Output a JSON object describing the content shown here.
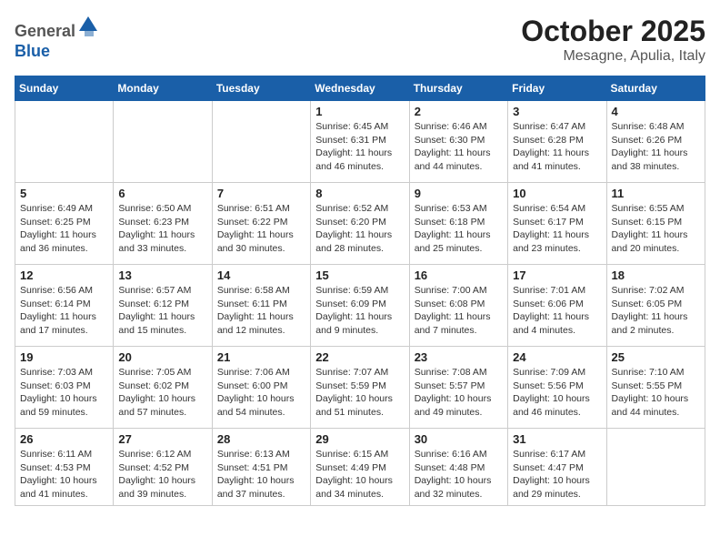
{
  "header": {
    "logo": {
      "general": "General",
      "blue": "Blue"
    },
    "title": "October 2025",
    "location": "Mesagne, Apulia, Italy"
  },
  "weekdays": [
    "Sunday",
    "Monday",
    "Tuesday",
    "Wednesday",
    "Thursday",
    "Friday",
    "Saturday"
  ],
  "weeks": [
    [
      {
        "day": "",
        "info": ""
      },
      {
        "day": "",
        "info": ""
      },
      {
        "day": "",
        "info": ""
      },
      {
        "day": "1",
        "info": "Sunrise: 6:45 AM\nSunset: 6:31 PM\nDaylight: 11 hours\nand 46 minutes."
      },
      {
        "day": "2",
        "info": "Sunrise: 6:46 AM\nSunset: 6:30 PM\nDaylight: 11 hours\nand 44 minutes."
      },
      {
        "day": "3",
        "info": "Sunrise: 6:47 AM\nSunset: 6:28 PM\nDaylight: 11 hours\nand 41 minutes."
      },
      {
        "day": "4",
        "info": "Sunrise: 6:48 AM\nSunset: 6:26 PM\nDaylight: 11 hours\nand 38 minutes."
      }
    ],
    [
      {
        "day": "5",
        "info": "Sunrise: 6:49 AM\nSunset: 6:25 PM\nDaylight: 11 hours\nand 36 minutes."
      },
      {
        "day": "6",
        "info": "Sunrise: 6:50 AM\nSunset: 6:23 PM\nDaylight: 11 hours\nand 33 minutes."
      },
      {
        "day": "7",
        "info": "Sunrise: 6:51 AM\nSunset: 6:22 PM\nDaylight: 11 hours\nand 30 minutes."
      },
      {
        "day": "8",
        "info": "Sunrise: 6:52 AM\nSunset: 6:20 PM\nDaylight: 11 hours\nand 28 minutes."
      },
      {
        "day": "9",
        "info": "Sunrise: 6:53 AM\nSunset: 6:18 PM\nDaylight: 11 hours\nand 25 minutes."
      },
      {
        "day": "10",
        "info": "Sunrise: 6:54 AM\nSunset: 6:17 PM\nDaylight: 11 hours\nand 23 minutes."
      },
      {
        "day": "11",
        "info": "Sunrise: 6:55 AM\nSunset: 6:15 PM\nDaylight: 11 hours\nand 20 minutes."
      }
    ],
    [
      {
        "day": "12",
        "info": "Sunrise: 6:56 AM\nSunset: 6:14 PM\nDaylight: 11 hours\nand 17 minutes."
      },
      {
        "day": "13",
        "info": "Sunrise: 6:57 AM\nSunset: 6:12 PM\nDaylight: 11 hours\nand 15 minutes."
      },
      {
        "day": "14",
        "info": "Sunrise: 6:58 AM\nSunset: 6:11 PM\nDaylight: 11 hours\nand 12 minutes."
      },
      {
        "day": "15",
        "info": "Sunrise: 6:59 AM\nSunset: 6:09 PM\nDaylight: 11 hours\nand 9 minutes."
      },
      {
        "day": "16",
        "info": "Sunrise: 7:00 AM\nSunset: 6:08 PM\nDaylight: 11 hours\nand 7 minutes."
      },
      {
        "day": "17",
        "info": "Sunrise: 7:01 AM\nSunset: 6:06 PM\nDaylight: 11 hours\nand 4 minutes."
      },
      {
        "day": "18",
        "info": "Sunrise: 7:02 AM\nSunset: 6:05 PM\nDaylight: 11 hours\nand 2 minutes."
      }
    ],
    [
      {
        "day": "19",
        "info": "Sunrise: 7:03 AM\nSunset: 6:03 PM\nDaylight: 10 hours\nand 59 minutes."
      },
      {
        "day": "20",
        "info": "Sunrise: 7:05 AM\nSunset: 6:02 PM\nDaylight: 10 hours\nand 57 minutes."
      },
      {
        "day": "21",
        "info": "Sunrise: 7:06 AM\nSunset: 6:00 PM\nDaylight: 10 hours\nand 54 minutes."
      },
      {
        "day": "22",
        "info": "Sunrise: 7:07 AM\nSunset: 5:59 PM\nDaylight: 10 hours\nand 51 minutes."
      },
      {
        "day": "23",
        "info": "Sunrise: 7:08 AM\nSunset: 5:57 PM\nDaylight: 10 hours\nand 49 minutes."
      },
      {
        "day": "24",
        "info": "Sunrise: 7:09 AM\nSunset: 5:56 PM\nDaylight: 10 hours\nand 46 minutes."
      },
      {
        "day": "25",
        "info": "Sunrise: 7:10 AM\nSunset: 5:55 PM\nDaylight: 10 hours\nand 44 minutes."
      }
    ],
    [
      {
        "day": "26",
        "info": "Sunrise: 6:11 AM\nSunset: 4:53 PM\nDaylight: 10 hours\nand 41 minutes."
      },
      {
        "day": "27",
        "info": "Sunrise: 6:12 AM\nSunset: 4:52 PM\nDaylight: 10 hours\nand 39 minutes."
      },
      {
        "day": "28",
        "info": "Sunrise: 6:13 AM\nSunset: 4:51 PM\nDaylight: 10 hours\nand 37 minutes."
      },
      {
        "day": "29",
        "info": "Sunrise: 6:15 AM\nSunset: 4:49 PM\nDaylight: 10 hours\nand 34 minutes."
      },
      {
        "day": "30",
        "info": "Sunrise: 6:16 AM\nSunset: 4:48 PM\nDaylight: 10 hours\nand 32 minutes."
      },
      {
        "day": "31",
        "info": "Sunrise: 6:17 AM\nSunset: 4:47 PM\nDaylight: 10 hours\nand 29 minutes."
      },
      {
        "day": "",
        "info": ""
      }
    ]
  ]
}
